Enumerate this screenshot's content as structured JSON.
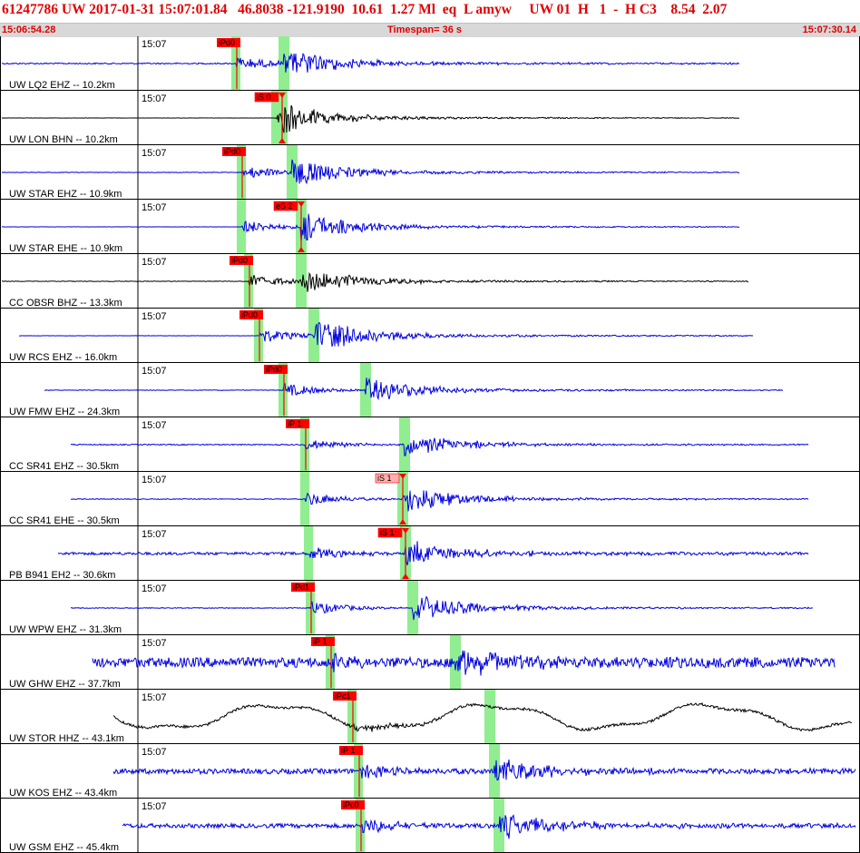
{
  "header": {
    "title": "61247786 UW 2017-01-31 15:07:01.84   46.8038 -121.9190  10.61  1.27 Ml  eq  L amyw     UW 01  H   1  -  H C3    8.54  2.07",
    "start_time": "15:06:54.28",
    "timespan": "Timespan=  36 s",
    "end_time": "15:07:30.14"
  },
  "colors": {
    "trace_blue": "#0000e0",
    "trace_black": "#000000",
    "pick_red": "#ff0000",
    "pick_pink": "#ffb0b0",
    "window_green": "#90ee90",
    "header_red": "#e00000"
  },
  "channels": [
    {
      "label": "UW LQ2 EHZ -- 10.2km",
      "time": "15:07",
      "pick_label": "iPd0",
      "s_label": "",
      "color": "blue",
      "amp": 0.5,
      "noise": 0.05,
      "start": 0.0,
      "end": 0.86,
      "p": 0.275,
      "s": 0.33
    },
    {
      "label": "UW LON BHN -- 10.2km",
      "time": "15:07",
      "pick_label": "",
      "s_label": "iS 0",
      "color": "black",
      "amp": 0.45,
      "noise": 0.01,
      "start": 0.0,
      "end": 0.86,
      "p": 0.322,
      "s": 0.328
    },
    {
      "label": "UW STAR EHZ -- 10.9km",
      "time": "15:07",
      "pick_label": "iPd0",
      "s_label": "",
      "color": "blue",
      "amp": 0.5,
      "noise": 0.02,
      "start": 0.0,
      "end": 0.86,
      "p": 0.282,
      "s": 0.34
    },
    {
      "label": "UW STAR EHE -- 10.9km",
      "time": "15:07",
      "pick_label": "",
      "s_label": "eS 2",
      "color": "blue",
      "amp": 0.5,
      "noise": 0.01,
      "start": 0.0,
      "end": 0.86,
      "p": 0.282,
      "s": 0.35
    },
    {
      "label": "CC OBSR BHZ -- 13.3km",
      "time": "15:07",
      "pick_label": "iPd0",
      "s_label": "",
      "color": "black",
      "amp": 0.5,
      "noise": 0.02,
      "start": 0.0,
      "end": 0.87,
      "p": 0.29,
      "s": 0.35
    },
    {
      "label": "UW RCS EHZ -- 16.0km",
      "time": "15:07",
      "pick_label": "iPd0",
      "s_label": "",
      "color": "blue",
      "amp": 0.55,
      "noise": 0.01,
      "start": 0.02,
      "end": 0.875,
      "p": 0.302,
      "s": 0.365
    },
    {
      "label": "UW FMW EHZ -- 24.3km",
      "time": "15:07",
      "pick_label": "iPd0",
      "s_label": "",
      "color": "blue",
      "amp": 0.5,
      "noise": 0.02,
      "start": 0.05,
      "end": 0.91,
      "p": 0.33,
      "s": 0.425
    },
    {
      "label": "CC SR41 EHZ -- 30.5km",
      "time": "15:07",
      "pick_label": "iP 1",
      "s_label": "",
      "color": "blue",
      "amp": 0.4,
      "noise": 0.05,
      "start": 0.08,
      "end": 0.94,
      "p": 0.356,
      "s": 0.47
    },
    {
      "label": "CC SR41 EHE -- 30.5km",
      "time": "15:07",
      "pick_label": "",
      "s_label": "iS 1",
      "color": "blue",
      "amp": 0.5,
      "noise": 0.03,
      "start": 0.08,
      "end": 0.94,
      "p": 0.356,
      "s": 0.468
    },
    {
      "label": "PB B941 EH2 -- 30.6km",
      "time": "15:07",
      "pick_label": "",
      "s_label": "iS 1",
      "color": "blue",
      "amp": 0.45,
      "noise": 0.12,
      "start": 0.065,
      "end": 0.94,
      "p": 0.36,
      "s": 0.472
    },
    {
      "label": "UW WPW EHZ -- 31.3km",
      "time": "15:07",
      "pick_label": "iPd1",
      "s_label": "",
      "color": "blue",
      "amp": 0.5,
      "noise": 0.03,
      "start": 0.08,
      "end": 0.945,
      "p": 0.362,
      "s": 0.48
    },
    {
      "label": "UW GHW EHZ -- 37.7km",
      "time": "15:07",
      "pick_label": "iP 1",
      "s_label": "",
      "color": "blue",
      "amp": 0.55,
      "noise": 0.35,
      "start": 0.105,
      "end": 0.97,
      "p": 0.385,
      "s": 0.53
    },
    {
      "label": "UW STOR HHZ -- 43.1km",
      "time": "15:07",
      "pick_label": "iPc1",
      "s_label": "",
      "color": "black",
      "amp": 0.45,
      "noise": 0.05,
      "start": 0.13,
      "end": 0.99,
      "p": 0.41,
      "s": 0.57
    },
    {
      "label": "UW KOS EHZ -- 43.4km",
      "time": "15:07",
      "pick_label": "iP 1",
      "s_label": "",
      "color": "blue",
      "amp": 0.5,
      "noise": 0.2,
      "start": 0.13,
      "end": 0.995,
      "p": 0.418,
      "s": 0.575
    },
    {
      "label": "UW GSM EHZ -- 45.4km",
      "time": "15:07",
      "pick_label": "iPc0",
      "s_label": "",
      "color": "blue",
      "amp": 0.55,
      "noise": 0.15,
      "start": 0.14,
      "end": 0.995,
      "p": 0.42,
      "s": 0.58
    }
  ]
}
